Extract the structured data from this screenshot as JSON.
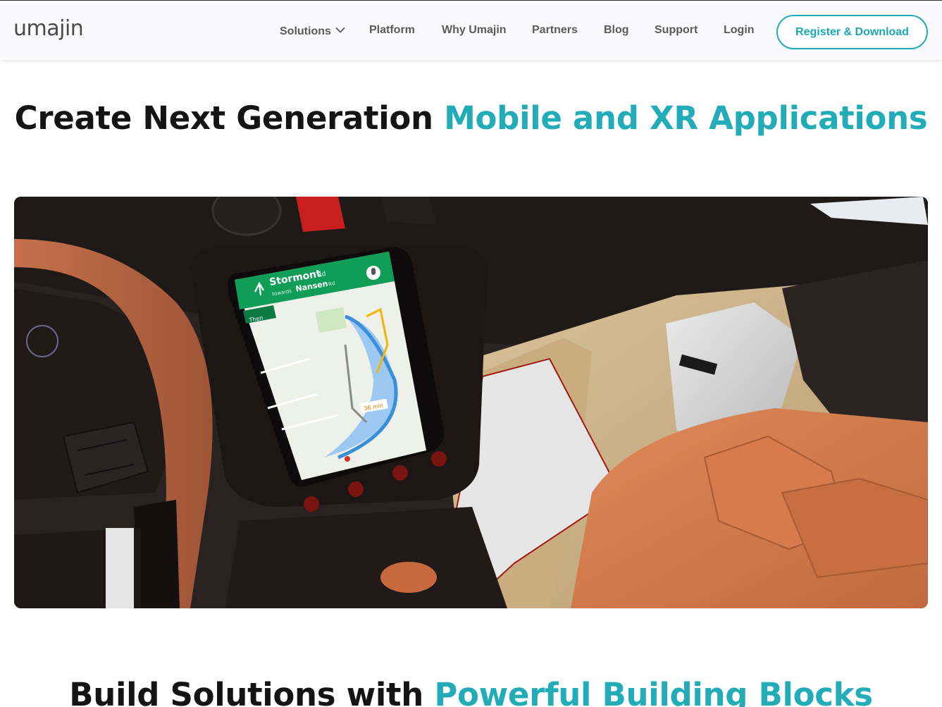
{
  "header": {
    "logo_text": "umajin",
    "nav": [
      {
        "label": "Solutions",
        "has_dropdown": true
      },
      {
        "label": "Platform"
      },
      {
        "label": "Why Umajin"
      },
      {
        "label": "Partners"
      },
      {
        "label": "Blog"
      },
      {
        "label": "Support"
      },
      {
        "label": "Login"
      }
    ],
    "cta_label": "Register & Download"
  },
  "hero": {
    "title_plain": "Create Next Generation ",
    "title_accent": "Mobile and XR Applications",
    "media": {
      "map": {
        "street": "Stormont",
        "street_suffix": "Rd",
        "towards_prefix": "towards",
        "towards": "Nansen",
        "towards_suffix": "Rd",
        "then_label": "Then",
        "eta": "36 min"
      }
    }
  },
  "next_section": {
    "title_plain": "Build Solutions with ",
    "title_accent": "Powerful Building Blocks"
  },
  "colors": {
    "accent": "#21acb8",
    "nav_text": "#5a5a5a",
    "heading": "#141414",
    "map_banner": "#0f9d58"
  }
}
